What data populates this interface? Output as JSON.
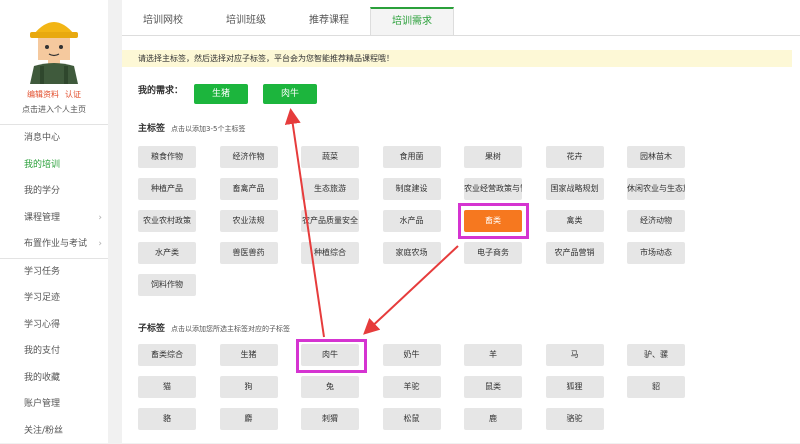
{
  "sidebar": {
    "edit_profile": "编辑资料",
    "verify": "认证",
    "home_link": "点击进入个人主页",
    "items": [
      {
        "label": "消息中心"
      },
      {
        "label": "我的培训"
      },
      {
        "label": "我的学分"
      },
      {
        "label": "课程管理"
      },
      {
        "label": "布置作业与考试"
      },
      {
        "label": "学习任务"
      },
      {
        "label": "学习足迹"
      },
      {
        "label": "学习心得"
      },
      {
        "label": "我的支付"
      },
      {
        "label": "我的收藏"
      },
      {
        "label": "账户管理"
      },
      {
        "label": "关注/粉丝"
      }
    ]
  },
  "tabs": [
    {
      "label": "培训网校"
    },
    {
      "label": "培训班级"
    },
    {
      "label": "推荐课程"
    },
    {
      "label": "培训需求"
    }
  ],
  "notice": "请选择主标签，然后选择对应子标签，平台会为您智能推荐精品课程哦！",
  "my_needs": {
    "label": "我的需求：",
    "items": [
      "生猪",
      "肉牛"
    ]
  },
  "main_tags": {
    "title": "主标签",
    "hint": "点击以添加3-5个主标签",
    "rows": [
      [
        "粮食作物",
        "经济作物",
        "蔬菜",
        "食用菌",
        "果树",
        "花卉",
        "园林苗木"
      ],
      [
        "种植产品",
        "畜禽产品",
        "生态旅游",
        "制度建设",
        "农业经营政策与管理",
        "国家战略规划",
        "休闲农业与生态旅游"
      ],
      [
        "农业农村政策",
        "农业法规",
        "农产品质量安全",
        "水产品",
        "畜类",
        "禽类",
        "经济动物"
      ],
      [
        "水产类",
        "兽医兽药",
        "种植综合",
        "家庭农场",
        "电子商务",
        "农产品营销",
        "市场动态"
      ],
      [
        "饲料作物"
      ]
    ],
    "selected": "畜类"
  },
  "sub_tags": {
    "title": "子标签",
    "hint": "点击以添加您所选主标签对应的子标签",
    "rows": [
      [
        "畜类综合",
        "生猪",
        "肉牛",
        "奶牛",
        "羊",
        "马",
        "驴、骡"
      ],
      [
        "猫",
        "狗",
        "兔",
        "羊驼",
        "鼠类",
        "狐狸",
        "貂"
      ],
      [
        "貉",
        "麝",
        "刺猬",
        "松鼠",
        "鹿",
        "骆驼"
      ]
    ],
    "highlighted": "肉牛"
  },
  "colors": {
    "accent_green": "#1cb53d",
    "selected_orange": "#f6781f",
    "highlight_magenta": "#d534d1",
    "arrow_red": "#e63c3c"
  }
}
